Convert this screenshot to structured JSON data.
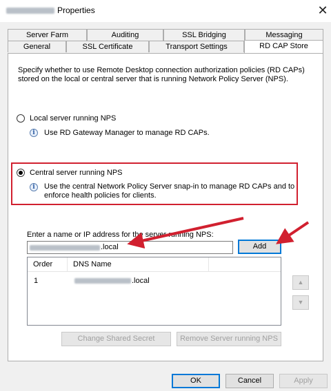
{
  "window": {
    "title": "Properties",
    "close_symbol": "✕"
  },
  "tabs": {
    "row1": [
      "Server Farm",
      "Auditing",
      "SSL Bridging",
      "Messaging"
    ],
    "row2": [
      "General",
      "SSL Certificate",
      "Transport Settings",
      "RD CAP Store"
    ],
    "active": "RD CAP Store"
  },
  "panel": {
    "description_line1": "Specify whether to use Remote Desktop connection authorization policies (RD CAPs)",
    "description_line2": "stored on the local or central server that is running Network Policy Server (NPS).",
    "local_option": {
      "label": "Local server running NPS",
      "info": "Use RD Gateway Manager to manage RD CAPs.",
      "selected": false
    },
    "central_option": {
      "label": "Central server running NPS",
      "info_line1": "Use the central Network Policy Server snap-in to manage RD CAPs and to",
      "info_line2": "enforce health policies for clients.",
      "selected": true
    },
    "server_name_label": "Enter a name or IP address for the server running NPS:",
    "server_name_suffix": ".local",
    "add_button": "Add",
    "list": {
      "columns": [
        "Order",
        "DNS Name"
      ],
      "rows": [
        {
          "order": "1",
          "dns_suffix": ".local"
        }
      ]
    },
    "up_arrow": "▲",
    "down_arrow": "▼",
    "change_secret_button": "Change Shared Secret",
    "remove_server_button": "Remove Server running NPS"
  },
  "footer": {
    "ok": "OK",
    "cancel": "Cancel",
    "apply": "Apply"
  },
  "colors": {
    "annotation_red": "#d1202f",
    "info_blue": "#2a5aa0",
    "focus_blue": "#0078d7"
  },
  "icons": {
    "info": "info-icon",
    "close": "close-icon"
  }
}
